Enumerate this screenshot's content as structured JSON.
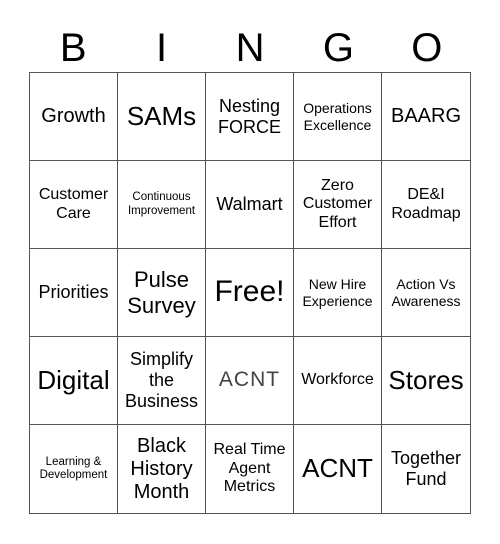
{
  "header": [
    "B",
    "I",
    "N",
    "G",
    "O"
  ],
  "cells": [
    "Growth",
    "SAMs",
    "Nesting\nFORCE",
    "Operations\nExcellence",
    "BAARG",
    "Customer\nCare",
    "Continuous\nImprovement",
    "Walmart",
    "Zero\nCustomer\nEffort",
    "DE&I\nRoadmap",
    "Priorities",
    "Pulse\nSurvey",
    "Free!",
    "New Hire\nExperience",
    "Action Vs\nAwareness",
    "Digital",
    "Simplify\nthe\nBusiness",
    "ACNT",
    "Workforce",
    "Stores",
    "Learning &\nDevelopment",
    "Black\nHistory\nMonth",
    "Real Time\nAgent\nMetrics",
    "ACNT",
    "Together\nFund"
  ]
}
